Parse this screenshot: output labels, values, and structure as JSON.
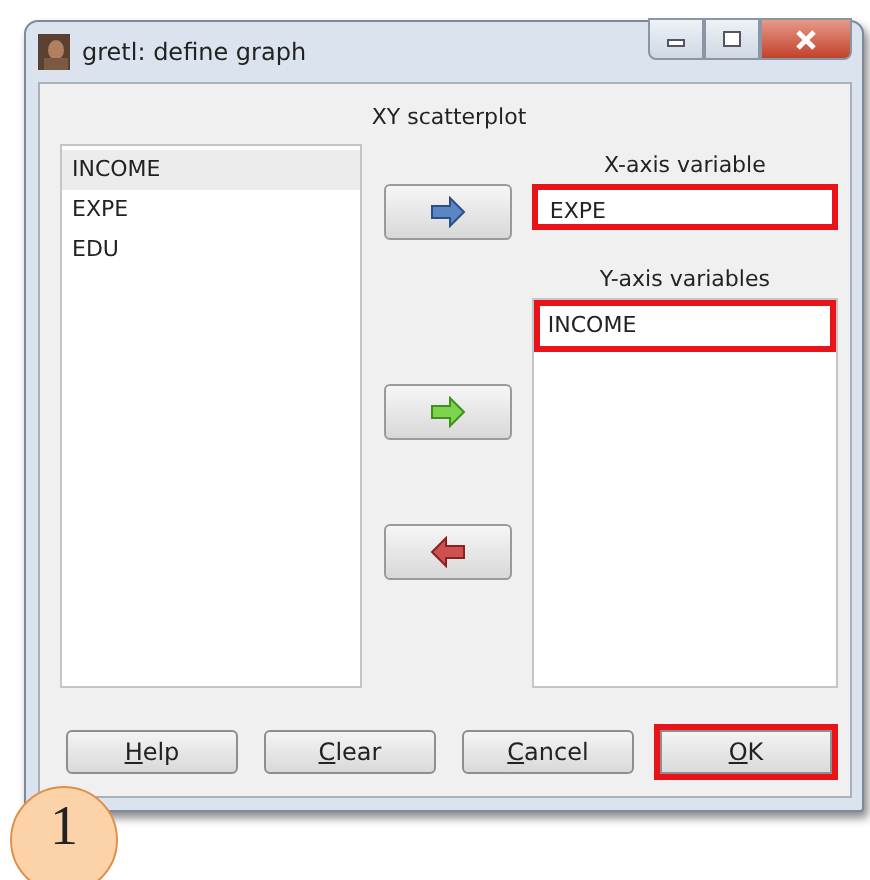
{
  "window": {
    "title": "gretl: define graph"
  },
  "heading": "XY scatterplot",
  "variables": [
    {
      "label": "INCOME",
      "selected": true
    },
    {
      "label": "EXPE",
      "selected": false
    },
    {
      "label": "EDU",
      "selected": false
    }
  ],
  "arrow_buttons": [
    {
      "kind": "add_x"
    },
    {
      "kind": "add_y"
    },
    {
      "kind": "remove"
    }
  ],
  "x_axis": {
    "label": "X-axis variable",
    "value": "EXPE",
    "highlighted": true
  },
  "y_axis": {
    "label": "Y-axis variables",
    "items": [
      {
        "label": "INCOME",
        "highlighted": true
      }
    ]
  },
  "buttons": [
    {
      "label": "Help",
      "underlined_first": true,
      "highlighted": false
    },
    {
      "label": "Clear",
      "underlined_first": true,
      "highlighted": false
    },
    {
      "label": "Cancel",
      "underlined_first": true,
      "highlighted": false
    },
    {
      "label": "OK",
      "underlined_first": true,
      "highlighted": true
    }
  ],
  "step_badge": {
    "text": "1"
  }
}
